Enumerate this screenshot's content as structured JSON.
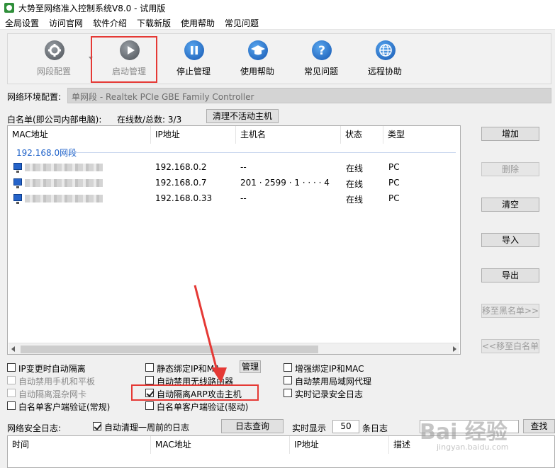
{
  "window": {
    "title": "大势至网络准入控制系统V8.0 - 试用版"
  },
  "menu": [
    "全局设置",
    "访问官网",
    "软件介绍",
    "下载新版",
    "使用帮助",
    "常见问题"
  ],
  "toolbar": [
    {
      "label": "网段配置",
      "icon": "gear-icon",
      "enabled": false
    },
    {
      "label": "启动管理",
      "icon": "play-icon",
      "enabled": false,
      "highlighted": true
    },
    {
      "label": "停止管理",
      "icon": "pause-icon",
      "enabled": true
    },
    {
      "label": "使用帮助",
      "icon": "graduation-cap-icon",
      "enabled": true
    },
    {
      "label": "常见问题",
      "icon": "question-icon",
      "enabled": true
    },
    {
      "label": "远程协助",
      "icon": "globe-icon",
      "enabled": true
    }
  ],
  "env": {
    "label": "网络环境配置:",
    "value": "单网段 - Realtek PCIe GBE Family Controller"
  },
  "whitelist": {
    "label": "白名单(即公司内部电脑):",
    "online_label": "在线数/总数: 3/3",
    "clear_inactive_label": "清理不活动主机",
    "columns": [
      "MAC地址",
      "IP地址",
      "主机名",
      "状态",
      "类型"
    ],
    "group": "192.168.0网段",
    "rows": [
      {
        "ip": "192.168.0.2",
        "host": "--",
        "status": "在线",
        "type": "PC"
      },
      {
        "ip": "192.168.0.7",
        "host": "201 · 2599 · 1 · · · · 4",
        "status": "在线",
        "type": "PC"
      },
      {
        "ip": "192.168.0.33",
        "host": "--",
        "status": "在线",
        "type": "PC"
      }
    ]
  },
  "side_buttons": [
    {
      "label": "增加",
      "enabled": true
    },
    {
      "label": "删除",
      "enabled": false
    },
    {
      "label": "清空",
      "enabled": true
    },
    {
      "label": "导入",
      "enabled": true
    },
    {
      "label": "导出",
      "enabled": true
    },
    {
      "label": "移至黑名单>>",
      "enabled": false
    },
    {
      "label": "<<移至白名单",
      "enabled": false
    }
  ],
  "options": {
    "col1": [
      {
        "label": "IP变更时自动隔离",
        "checked": false,
        "enabled": true
      },
      {
        "label": "自动禁用手机和平板",
        "checked": false,
        "enabled": false
      },
      {
        "label": "自动隔离混杂网卡",
        "checked": false,
        "enabled": false
      },
      {
        "label": "白名单客户端验证(常规)",
        "checked": false,
        "enabled": true
      }
    ],
    "col2": [
      {
        "label": "静态绑定IP和MA",
        "checked": false,
        "enabled": true
      },
      {
        "label": "自动禁用无线路由器",
        "checked": false,
        "enabled": true
      },
      {
        "label": "自动隔离ARP攻击主机",
        "checked": true,
        "enabled": true,
        "highlighted": true
      },
      {
        "label": "白名单客户端验证(驱动)",
        "checked": false,
        "enabled": true
      }
    ],
    "manage_label": "管理",
    "col3": [
      {
        "label": "增强绑定IP和MAC",
        "checked": false,
        "enabled": true
      },
      {
        "label": "自动禁用局域网代理",
        "checked": false,
        "enabled": true
      },
      {
        "label": "实时记录安全日志",
        "checked": false,
        "enabled": true
      }
    ]
  },
  "log": {
    "label": "网络安全日志:",
    "auto_clear_label": "自动清理一周前的日志",
    "auto_clear_checked": true,
    "query_label": "日志查询",
    "realtime_label": "实时显示",
    "realtime_value": "50",
    "unit_label": "条日志",
    "search_label": "查找",
    "columns": [
      "时间",
      "MAC地址",
      "IP地址",
      "描述"
    ]
  },
  "watermark": {
    "big": "Bai 经验",
    "small": "jingyan.baidu.com"
  },
  "colors": {
    "highlight": "#e53935",
    "accent": "#1f62c9"
  }
}
